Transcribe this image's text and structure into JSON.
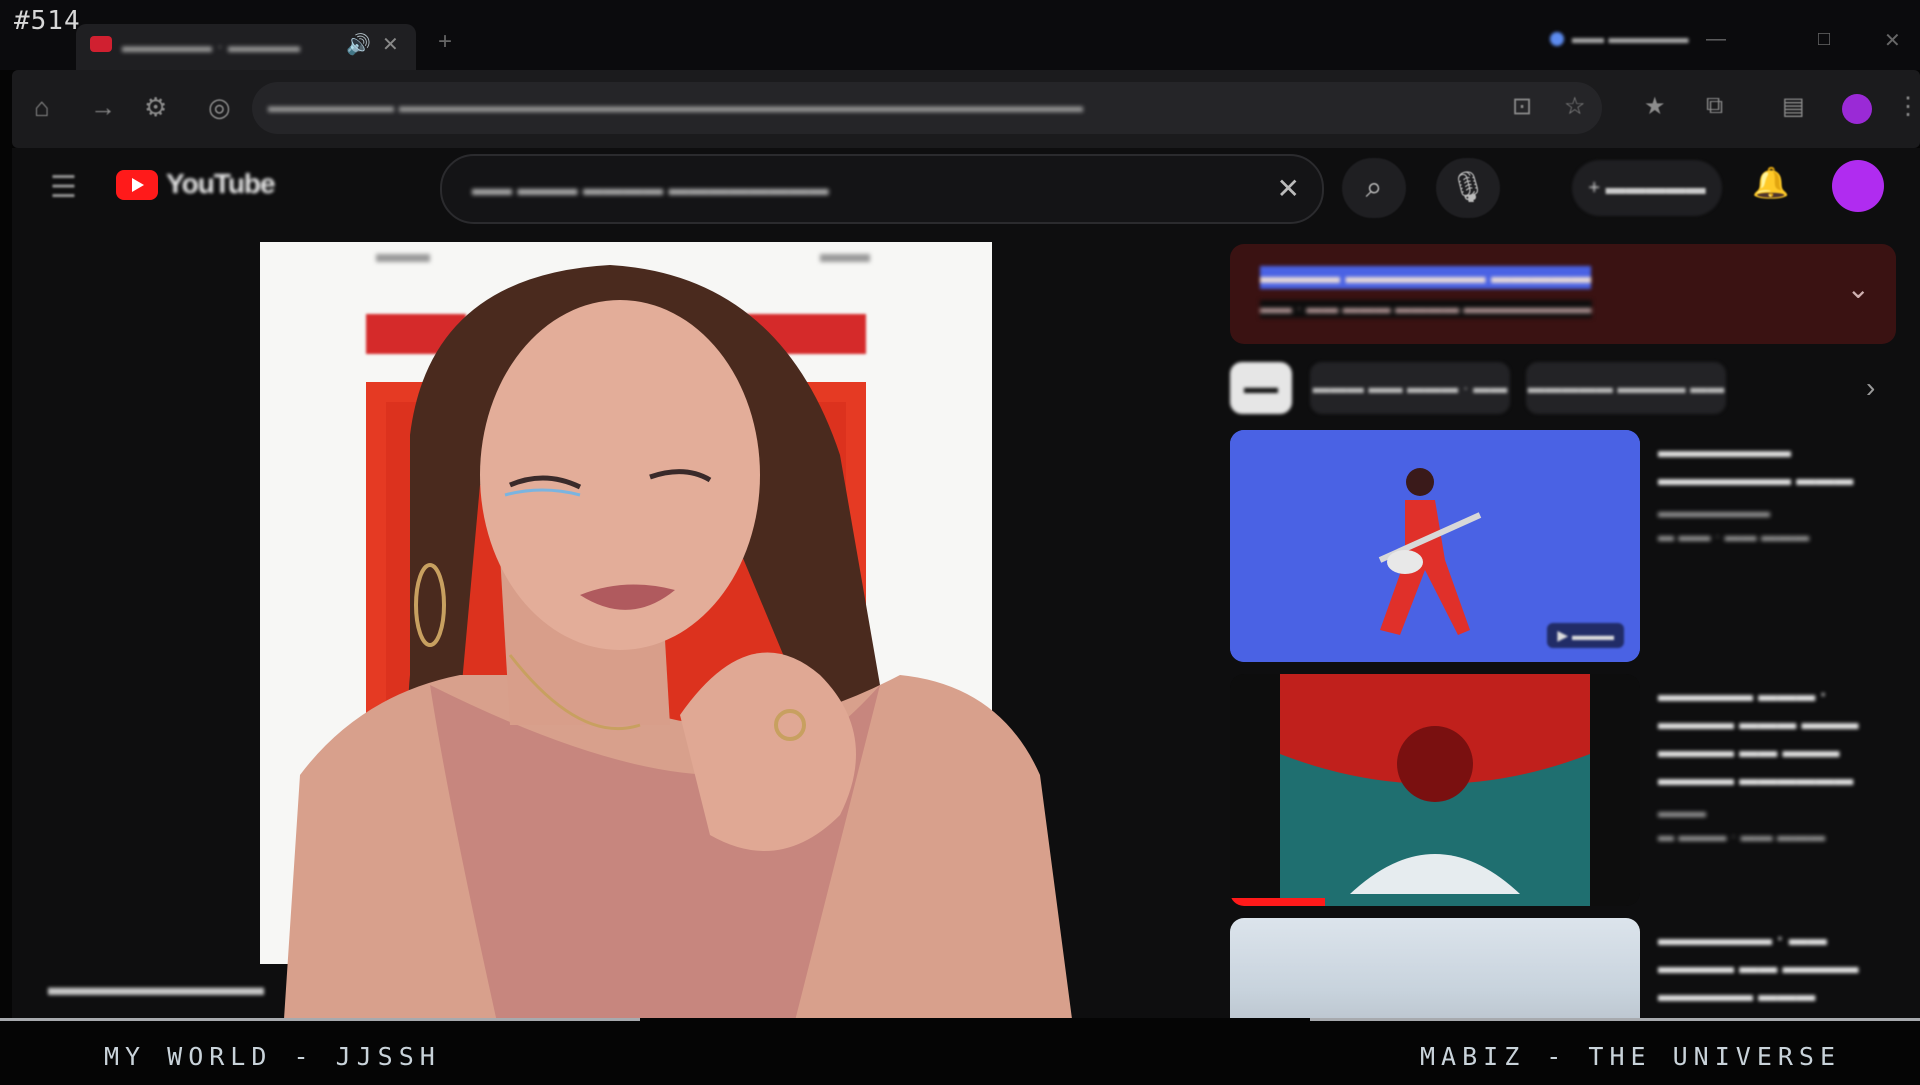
{
  "stream": {
    "episode": "#514",
    "now_playing_left": "MY WORLD - JJSSH",
    "now_playing_right": "MABIZ - THE UNIVERSE"
  },
  "browser": {
    "tab_title": "",
    "address": "",
    "profile_label": ""
  },
  "youtube": {
    "search_value": "",
    "create_label": "",
    "channel_label": "",
    "notice_title": "",
    "notice_subtitle": "",
    "chips": [
      "",
      "",
      ""
    ],
    "recommendations": [
      {
        "title": "",
        "channel": "",
        "stats": "",
        "thumb": "guitarist-blue"
      },
      {
        "title": "",
        "channel": "",
        "stats": "",
        "thumb": "red-abstract"
      },
      {
        "title": "",
        "channel": "",
        "stats": "",
        "thumb": "sky-landscape"
      }
    ]
  },
  "colors": {
    "youtube_red": "#ff1a1a",
    "notice_bg": "#3a1212",
    "avatar": "#b02cf0",
    "thumb_blue": "#4a62e4"
  },
  "icons": [
    "home-icon",
    "refresh-icon",
    "tune-icon",
    "site-info-icon",
    "menu-icon",
    "search-icon",
    "mic-icon",
    "bell-icon",
    "plus-icon",
    "close-icon",
    "chevron-down-icon",
    "chevron-right-icon"
  ]
}
